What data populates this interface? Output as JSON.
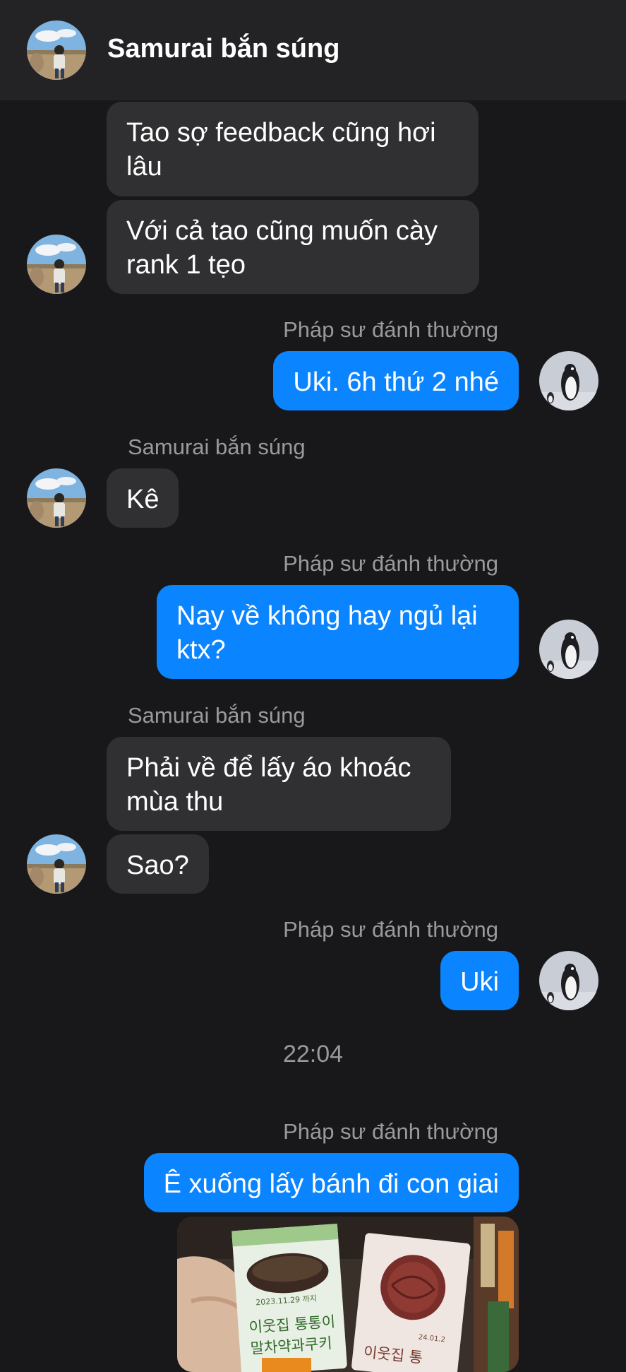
{
  "header": {
    "title": "Samurai bắn súng"
  },
  "messages": [
    {
      "text": "Tao sợ feedback cũng hơi lâu",
      "direction": "incoming"
    },
    {
      "text": "Với cả tao cũng muốn cày rank 1 tẹo",
      "direction": "incoming"
    },
    {
      "sender": "Pháp sư đánh thường",
      "text": "Uki. 6h thứ 2 nhé",
      "direction": "outgoing"
    },
    {
      "sender": "Samurai bắn súng",
      "text": "Kê",
      "direction": "incoming"
    },
    {
      "sender": "Pháp sư đánh thường",
      "text": "Nay về không hay ngủ lại ktx?",
      "direction": "outgoing"
    },
    {
      "sender": "Samurai bắn súng",
      "text": "Phải về để lấy áo khoác mùa thu",
      "direction": "incoming"
    },
    {
      "text": "Sao?",
      "direction": "incoming"
    },
    {
      "sender": "Pháp sư đánh thường",
      "text": "Uki",
      "direction": "outgoing"
    },
    {
      "sender": "Pháp sư đánh thường",
      "text": "Ê xuống lấy bánh đi con giai",
      "direction": "outgoing"
    }
  ],
  "timestamp": "22:04",
  "photo": {
    "package_left_date": "2023.11.29 까지",
    "package_left_line1": "이웃집 통통이",
    "package_left_line2": "말차약과쿠키",
    "package_right_text": "이웃집 통",
    "package_right_date": "24.01.2"
  },
  "colors": {
    "background": "#18181a",
    "header": "#232325",
    "incoming_bubble": "#303032",
    "outgoing_bubble": "#0a84ff",
    "sender_label": "#9a9a9e"
  },
  "icons": {
    "contact_avatar": "person-in-field-avatar",
    "my_avatar": "penguin-avatar"
  }
}
